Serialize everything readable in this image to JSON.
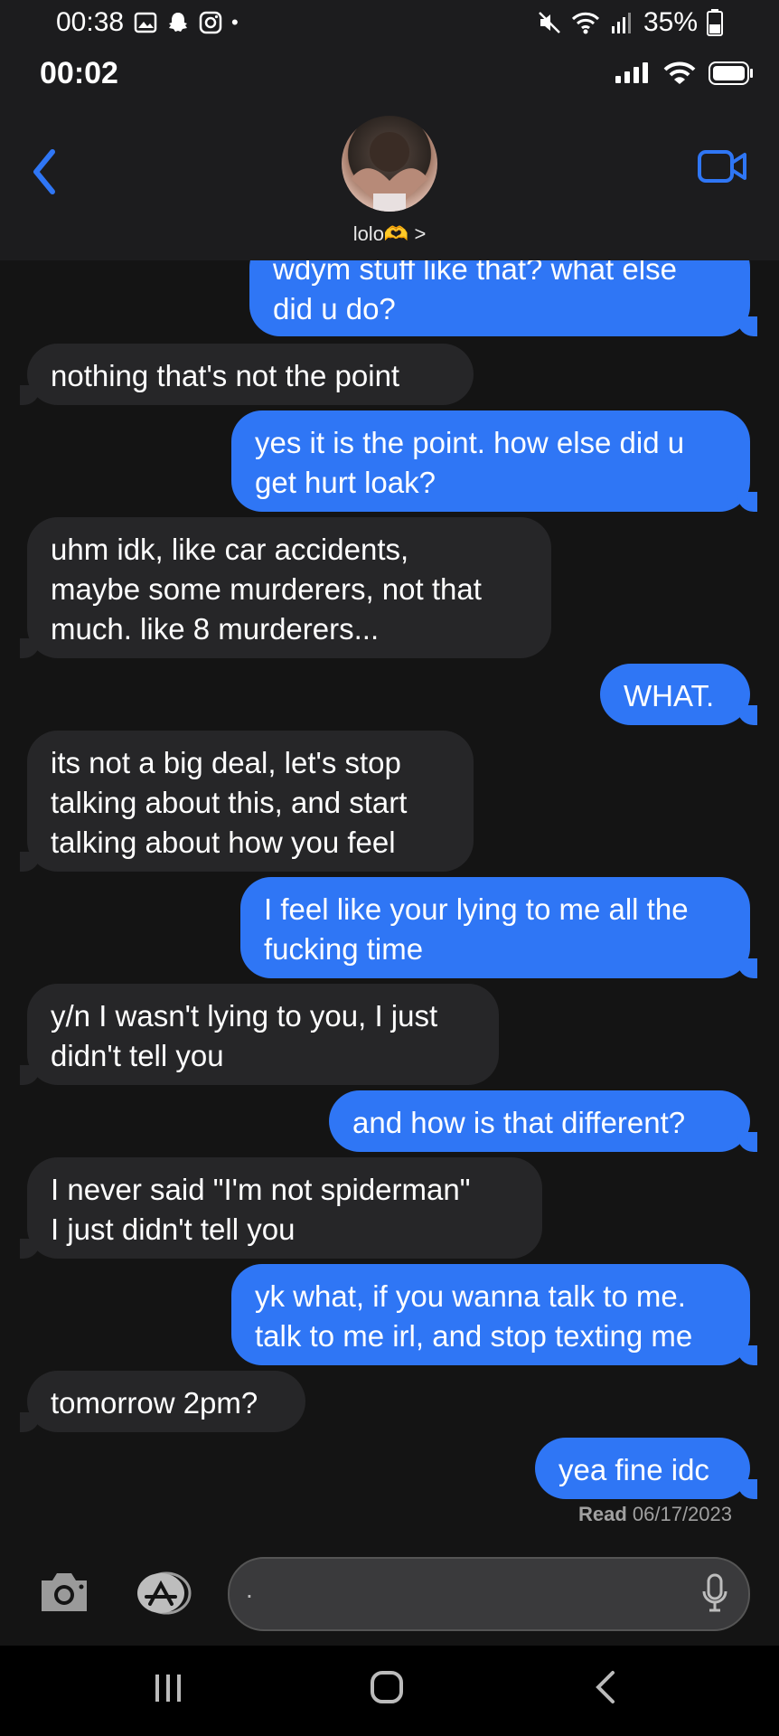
{
  "android_status": {
    "time": "00:38",
    "battery": "35%"
  },
  "ios_status": {
    "time": "00:02"
  },
  "contact": {
    "name": "lolo🫶 >"
  },
  "messages": [
    {
      "from": "me",
      "text": "wdym stuff like that? what else\ndid u do?"
    },
    {
      "from": "them",
      "text": "nothing that's not the point"
    },
    {
      "from": "me",
      "text": "yes it is the point. how else did u\nget hurt loak?"
    },
    {
      "from": "them",
      "text": "uhm idk, like car accidents,\nmaybe some murderers, not that\nmuch. like 8 murderers..."
    },
    {
      "from": "me",
      "text": "WHAT."
    },
    {
      "from": "them",
      "text": "its not a big deal, let's stop\ntalking about this, and start\ntalking about how you feel"
    },
    {
      "from": "me",
      "text": "I feel like your lying to me all the\nfucking time"
    },
    {
      "from": "them",
      "text": "y/n I wasn't lying to you, I just\ndidn't tell you"
    },
    {
      "from": "me",
      "text": "and how is that different?"
    },
    {
      "from": "them",
      "text": "I never said \"I'm not spiderman\"\nI just didn't tell you"
    },
    {
      "from": "me",
      "text": "yk what, if you wanna talk to me.\ntalk to me irl, and stop texting me"
    },
    {
      "from": "them",
      "text": "tomorrow 2pm?"
    },
    {
      "from": "me",
      "text": "yea fine idc"
    }
  ],
  "read_receipt": {
    "label": "Read",
    "date": "06/17/2023"
  },
  "composer": {
    "value": "."
  },
  "colors": {
    "sent_bubble": "#2f76f5",
    "received_bubble": "#262628",
    "accent": "#2f76f5"
  },
  "icons": [
    "back-chevron-icon",
    "video-camera-icon",
    "camera-icon",
    "app-store-icon",
    "microphone-icon",
    "wifi-icon",
    "signal-icon",
    "battery-icon"
  ]
}
